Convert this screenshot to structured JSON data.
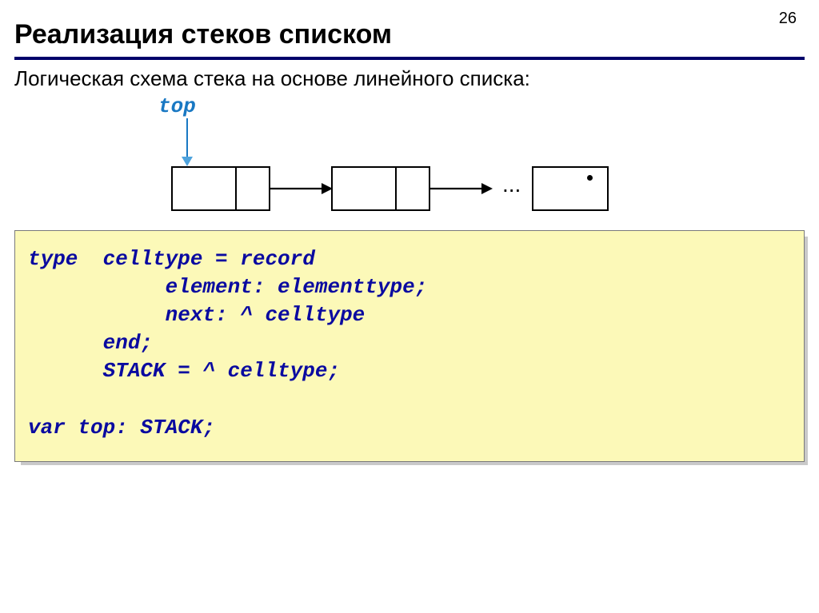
{
  "page_number": "26",
  "heading": "Реализация стеков списком",
  "subtitle": "Логическая схема стека на основе линейного списка:",
  "top_label": "top",
  "ellipsis": "...",
  "code": {
    "l1": "type  celltype = record",
    "l2": "           element: elementtype;",
    "l3": "           next: ^ celltype",
    "l4": "      end;",
    "l5": "      STACK = ^ celltype;",
    "l6": "",
    "l7": "var top: STACK;"
  }
}
